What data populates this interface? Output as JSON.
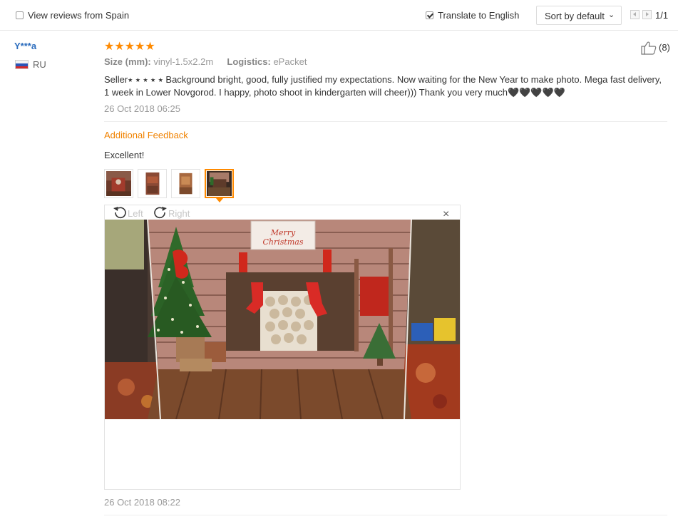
{
  "filters": {
    "country_reviews": {
      "label": "View reviews from Spain",
      "checked": false
    },
    "translate": {
      "label": "Translate to English",
      "checked": true
    },
    "sort": {
      "selected": "Sort by default"
    },
    "pagination": {
      "text": "1/1"
    }
  },
  "review": {
    "user": "Y***a",
    "country_code": "RU",
    "rating": 5,
    "stars": "★★★★★",
    "likes": "(8)",
    "size_label": "Size (mm):",
    "size_value": "vinyl-1.5x2.2m",
    "logistics_label": "Logistics:",
    "logistics_value": "ePacket",
    "text": "Seller⭑ ⭑ ⭑ ⭑ ⭑ Background bright, good, fully justified my expectations. Now waiting for the New Year to make photo. Mega fast delivery, 1 week in Lower Novgorod. I happy, photo shoot in kindergarten will cheer))) Thank you very much🖤🖤🖤🖤🖤",
    "date": "26 Oct 2018 06:25",
    "additional": {
      "title": "Additional Feedback",
      "text": "Excellent!",
      "date": "26 Oct 2018 08:22"
    },
    "photos": {
      "count": 4,
      "active_index": 3
    },
    "viewer": {
      "rotate_left": "Left",
      "rotate_right": "Right",
      "close": "×",
      "image_sign": "Merry Christmas"
    }
  },
  "colors": {
    "accent": "#ff8a00",
    "username": "#2b6cbd",
    "additional_title": "#f08200"
  },
  "icons": [
    "checkbox-icon",
    "chevron-down-icon",
    "prev-page-icon",
    "next-page-icon",
    "flag-ru-icon",
    "star-icon",
    "thumbs-up-icon",
    "rotate-left-icon",
    "rotate-right-icon",
    "close-icon"
  ]
}
